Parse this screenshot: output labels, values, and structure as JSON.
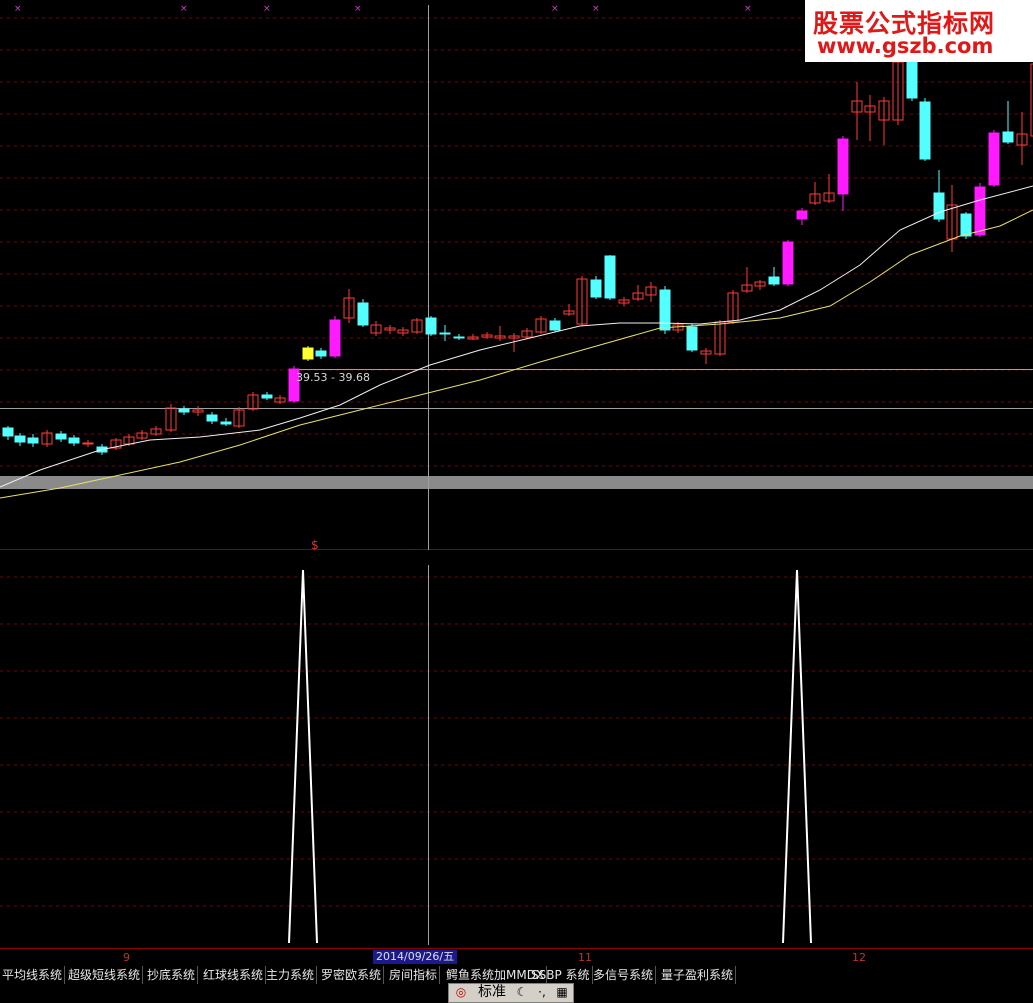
{
  "watermark": {
    "line1": "股票公式指标网",
    "line2": "www.gszb.com"
  },
  "main_chart": {
    "price_range_label": "39.53 - 39.68",
    "signal_marker": "$",
    "colors": {
      "up_candle": "#ff3b3b",
      "down_candle": "#54ffff",
      "highlight_up": "#ff1aff",
      "highlight_yellow": "#ffff33",
      "ma_white": "#f0f0f0",
      "ma_yellow": "#e8e070",
      "grid": "#7a0000"
    }
  },
  "sub_chart": {
    "spike_color": "#ffffff"
  },
  "time_axis": {
    "labels": [
      "9",
      "11",
      "12"
    ],
    "cursor_date": "2014/09/26/五"
  },
  "tabs": [
    "平均线系统",
    "超级短线系统",
    "抄底系统",
    "红球线系统",
    "主力系统",
    "罗密欧系统",
    "房间指标",
    "鳄鱼系统加MMDX",
    "SSBP 系统",
    "多信号系统",
    "量子盈利系统"
  ],
  "toolbar": {
    "mode_label": "标准",
    "moon_icon": "moon-icon",
    "punct_label": "·,",
    "keyboard_icon": "keyboard-icon"
  }
}
